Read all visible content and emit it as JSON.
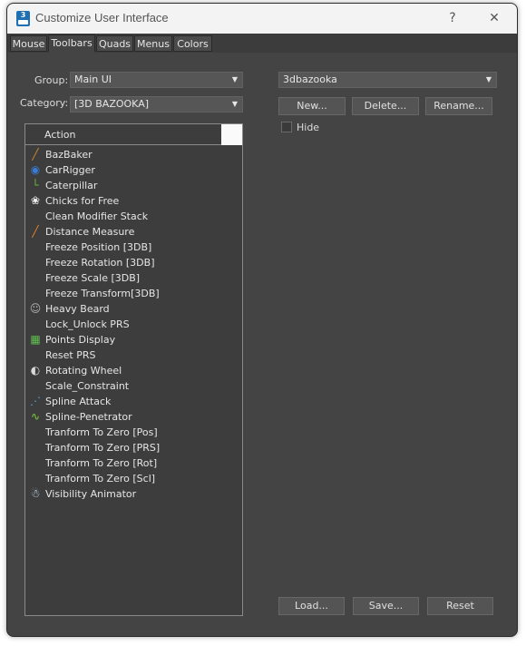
{
  "window": {
    "title": "Customize User Interface",
    "help_glyph": "?",
    "close_glyph": "✕",
    "app_icon_text": "3"
  },
  "tabs": [
    {
      "label": "Mouse",
      "active": false
    },
    {
      "label": "Toolbars",
      "active": true
    },
    {
      "label": "Quads",
      "active": false
    },
    {
      "label": "Menus",
      "active": false
    },
    {
      "label": "Colors",
      "active": false
    }
  ],
  "left": {
    "group_label": "Group:",
    "group_value": "Main UI",
    "category_label": "Category:",
    "category_value": "[3D BAZOOKA]",
    "list_header": "Action",
    "actions": [
      {
        "label": "BazBaker",
        "icon": "bazbaker-icon",
        "glyph": "╱",
        "color": "#c98a2c"
      },
      {
        "label": "CarRigger",
        "icon": "carrigger-icon",
        "glyph": "◉",
        "color": "#3a7bd5"
      },
      {
        "label": "Caterpillar",
        "icon": "caterpillar-icon",
        "glyph": "└",
        "color": "#69b83a"
      },
      {
        "label": "Chicks for Free",
        "icon": "chick-icon",
        "glyph": "❀",
        "color": "#f0f0f0"
      },
      {
        "label": "Clean Modifier Stack",
        "icon": "",
        "glyph": "",
        "color": ""
      },
      {
        "label": "Distance Measure",
        "icon": "ruler-icon",
        "glyph": "╱",
        "color": "#e8822a"
      },
      {
        "label": "Freeze Position [3DB]",
        "icon": "",
        "glyph": "",
        "color": ""
      },
      {
        "label": "Freeze Rotation [3DB]",
        "icon": "",
        "glyph": "",
        "color": ""
      },
      {
        "label": "Freeze Scale [3DB]",
        "icon": "",
        "glyph": "",
        "color": ""
      },
      {
        "label": "Freeze Transform[3DB]",
        "icon": "",
        "glyph": "",
        "color": ""
      },
      {
        "label": "Heavy Beard",
        "icon": "beard-icon",
        "glyph": "☺",
        "color": "#b0b0b0"
      },
      {
        "label": "Lock_Unlock PRS",
        "icon": "",
        "glyph": "",
        "color": ""
      },
      {
        "label": "Points Display",
        "icon": "globe-grid-icon",
        "glyph": "▦",
        "color": "#5fbf4f"
      },
      {
        "label": "Reset PRS",
        "icon": "",
        "glyph": "",
        "color": ""
      },
      {
        "label": "Rotating Wheel",
        "icon": "wheel-icon",
        "glyph": "◐",
        "color": "#d8d8d8"
      },
      {
        "label": "Scale_Constraint",
        "icon": "",
        "glyph": "",
        "color": ""
      },
      {
        "label": "Spline Attack",
        "icon": "spline-attack-icon",
        "glyph": "⋰",
        "color": "#4aa8e0"
      },
      {
        "label": "Spline-Penetrator",
        "icon": "spline-penetrator-icon",
        "glyph": "∿",
        "color": "#7bd13a"
      },
      {
        "label": "Tranform To Zero [Pos]",
        "icon": "",
        "glyph": "",
        "color": ""
      },
      {
        "label": "Tranform To Zero [PRS]",
        "icon": "",
        "glyph": "",
        "color": ""
      },
      {
        "label": "Tranform To Zero [Rot]",
        "icon": "",
        "glyph": "",
        "color": ""
      },
      {
        "label": "Tranform To Zero [Scl]",
        "icon": "",
        "glyph": "",
        "color": ""
      },
      {
        "label": "Visibility Animator",
        "icon": "ghost-icon",
        "glyph": "☃",
        "color": "#cfe6f5"
      }
    ]
  },
  "right": {
    "toolbar_value": "3dbazooka",
    "new_label": "New...",
    "delete_label": "Delete...",
    "rename_label": "Rename...",
    "hide_label": "Hide",
    "hide_checked": false,
    "load_label": "Load...",
    "save_label": "Save...",
    "reset_label": "Reset"
  },
  "colors": {
    "panel_bg": "#444444",
    "list_bg": "#3d3d3d",
    "app_icon": "#1f6fb2"
  }
}
